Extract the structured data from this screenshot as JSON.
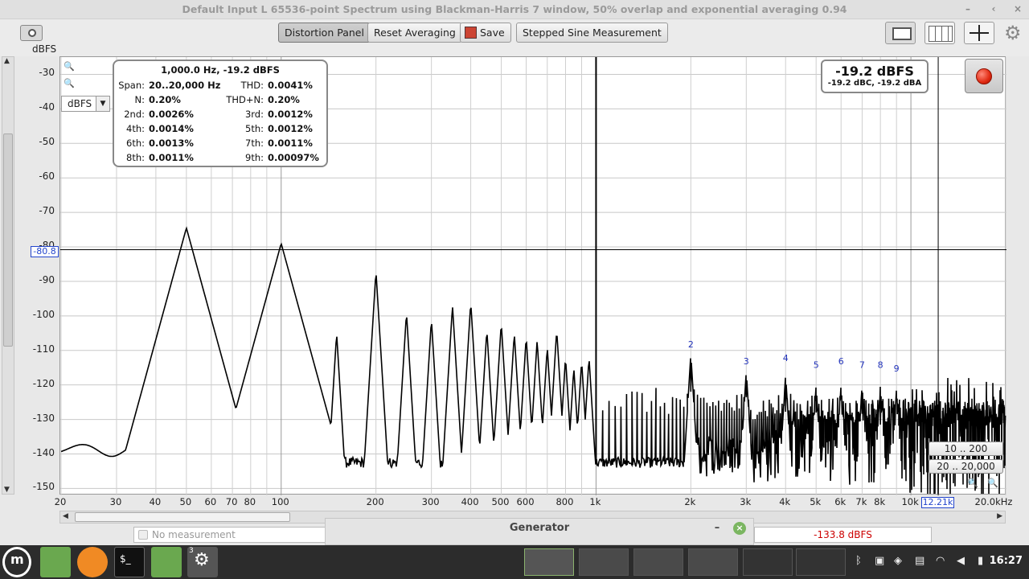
{
  "window": {
    "title": "Default Input L 65536-point Spectrum using Blackman-Harris 7 window, 50% overlap and exponential averaging 0.94",
    "minimize": "–",
    "maximize": "‹",
    "close": "×"
  },
  "toolbar": {
    "distortion_panel": "Distortion Panel",
    "reset_averaging": "Reset Averaging",
    "save": "Save",
    "stepped_sine": "Stepped Sine Measurement"
  },
  "axis": {
    "y_unit": "dBFS",
    "y_ticks": [
      "-30",
      "-40",
      "-50",
      "-60",
      "-70",
      "-80",
      "-90",
      "-100",
      "-110",
      "-120",
      "-130",
      "-140",
      "-150"
    ],
    "x_ticks": [
      "20",
      "30",
      "40",
      "50",
      "60",
      "70",
      "80",
      "100",
      "200",
      "300",
      "400",
      "500",
      "600",
      "800",
      "1k",
      "2k",
      "3k",
      "4k",
      "5k",
      "6k",
      "7k",
      "8k",
      "10k",
      "20.0kHz"
    ],
    "y_cursor": "-80.8",
    "x_cursor": "12.21k"
  },
  "distortion": {
    "header": "1,000.0 Hz, -19.2 dBFS",
    "span_label": "Span:",
    "span_value": "20..20,000 Hz",
    "thd_label": "THD:",
    "thd_value": "0.0041%",
    "n_label": "N:",
    "n_value": "0.20%",
    "thdn_label": "THD+N:",
    "thdn_value": "0.20%",
    "h2_label": "2nd:",
    "h2_value": "0.0026%",
    "h3_label": "3rd:",
    "h3_value": "0.0012%",
    "h4_label": "4th:",
    "h4_value": "0.0014%",
    "h5_label": "5th:",
    "h5_value": "0.0012%",
    "h6_label": "6th:",
    "h6_value": "0.0013%",
    "h7_label": "7th:",
    "h7_value": "0.0011%",
    "h8_label": "8th:",
    "h8_value": "0.0011%",
    "h9_label": "9th:",
    "h9_value": "0.00097%"
  },
  "level": {
    "main": "-19.2 dBFS",
    "sub": "-19.2 dBC, -19.2 dBA"
  },
  "unit_select": "dBFS",
  "range_buttons": [
    "10 .. 200",
    "20 .. 20,000"
  ],
  "status": {
    "no_measurement": "No measurement",
    "generator": "Generator",
    "gen_min": "–",
    "gen_close": "×",
    "measured": "-133.8 dBFS"
  },
  "taskbar": {
    "clock": "16:27",
    "badge": "3"
  },
  "chart_data": {
    "type": "line",
    "title": "",
    "xlabel": "",
    "ylabel": "dBFS",
    "x_scale": "log",
    "xlim": [
      20,
      20000
    ],
    "ylim": [
      -152,
      -25
    ],
    "grid": true,
    "fundamental": {
      "freq": 1000,
      "level": -19.2
    },
    "peaks": [
      {
        "freq": 50,
        "level": -74.5
      },
      {
        "freq": 100,
        "level": -79
      },
      {
        "freq": 150,
        "level": -105
      },
      {
        "freq": 200,
        "level": -87
      },
      {
        "freq": 250,
        "level": -99
      },
      {
        "freq": 300,
        "level": -101
      },
      {
        "freq": 350,
        "level": -97
      },
      {
        "freq": 400,
        "level": -96
      },
      {
        "freq": 450,
        "level": -104
      },
      {
        "freq": 500,
        "level": -102
      },
      {
        "freq": 550,
        "level": -105
      },
      {
        "freq": 600,
        "level": -106
      },
      {
        "freq": 650,
        "level": -107
      },
      {
        "freq": 700,
        "level": -109
      },
      {
        "freq": 750,
        "level": -104
      },
      {
        "freq": 800,
        "level": -112
      },
      {
        "freq": 850,
        "level": -115
      },
      {
        "freq": 900,
        "level": -113
      },
      {
        "freq": 950,
        "level": -112
      },
      {
        "freq": 2000,
        "level": -111
      },
      {
        "freq": 3000,
        "level": -116
      },
      {
        "freq": 4000,
        "level": -117
      },
      {
        "freq": 5000,
        "level": -120
      },
      {
        "freq": 6000,
        "level": -120
      },
      {
        "freq": 7000,
        "level": -120
      },
      {
        "freq": 8000,
        "level": -120
      },
      {
        "freq": 9000,
        "level": -121
      }
    ],
    "noise_floor": -142,
    "harmonic_markers": [
      {
        "label": "2",
        "freq": 2000,
        "level": -110
      },
      {
        "label": "3",
        "freq": 3000,
        "level": -115
      },
      {
        "label": "4",
        "freq": 4000,
        "level": -114
      },
      {
        "label": "5",
        "freq": 5000,
        "level": -116
      },
      {
        "label": "6",
        "freq": 6000,
        "level": -115
      },
      {
        "label": "7",
        "freq": 7000,
        "level": -116
      },
      {
        "label": "8",
        "freq": 8000,
        "level": -116
      },
      {
        "label": "9",
        "freq": 9000,
        "level": -117
      }
    ],
    "cursor": {
      "x": 12210,
      "y": -80.8
    }
  }
}
